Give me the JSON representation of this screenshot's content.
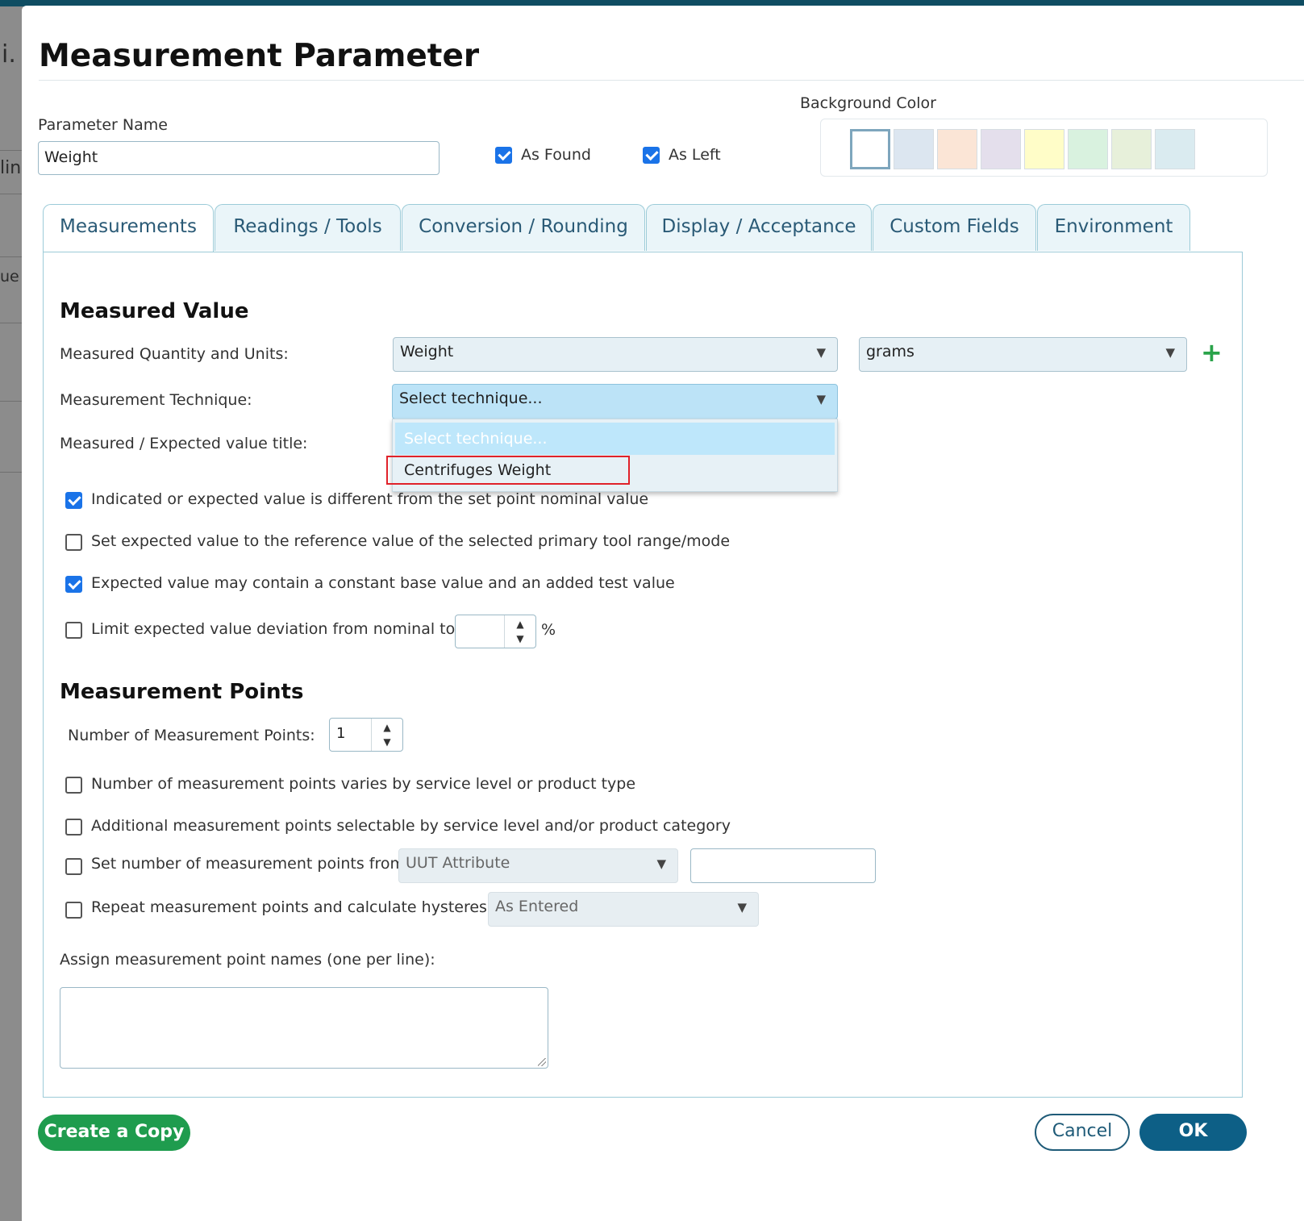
{
  "background_fragments": {
    "frag1": "i.",
    "frag2": "lin",
    "frag3": "ue"
  },
  "dialog": {
    "title": "Measurement Parameter",
    "parameter_name_label": "Parameter Name",
    "parameter_name_value": "Weight",
    "as_found_label": "As Found",
    "as_found_checked": true,
    "as_left_label": "As Left",
    "as_left_checked": true,
    "background_color_label": "Background Color",
    "background_colors": [
      "#ffffff",
      "#dce6f0",
      "#fbe5d6",
      "#e4dfec",
      "#fffdc8",
      "#d9f2df",
      "#e7f0da",
      "#daebf0"
    ],
    "selected_color_index": 0
  },
  "tabs": [
    "Measurements",
    "Readings / Tools",
    "Conversion / Rounding",
    "Display / Acceptance",
    "Custom Fields",
    "Environment"
  ],
  "active_tab": "Measurements",
  "measured_value": {
    "heading": "Measured Value",
    "quantity_label": "Measured Quantity and Units:",
    "quantity_value": "Weight",
    "units_value": "grams",
    "technique_label": "Measurement Technique:",
    "technique_value": "Select technique...",
    "technique_options": [
      "Select technique...",
      "Centrifuges Weight"
    ],
    "title_label": "Measured / Expected value title:",
    "options": [
      {
        "label": "Indicated or expected value is different from the set point nominal value",
        "checked": true
      },
      {
        "label": "Set expected value to the reference value of the selected primary tool range/mode",
        "checked": false
      },
      {
        "label": "Expected value may contain a constant base value and an added test value",
        "checked": true
      },
      {
        "label": "Limit expected value deviation from nominal to",
        "checked": false
      }
    ],
    "deviation_value": "",
    "deviation_unit": "%"
  },
  "measurement_points": {
    "heading": "Measurement Points",
    "count_label": "Number of Measurement Points:",
    "count_value": "1",
    "varies_label": "Number of measurement points varies by service level or product type",
    "additional_label": "Additional measurement points selectable by service level and/or product category",
    "set_from_label": "Set number of measurement points from",
    "set_from_select": "UUT Attribute",
    "set_from_value": "",
    "repeat_label": "Repeat measurement points and calculate hysteresis",
    "repeat_select": "As Entered",
    "names_label": "Assign measurement point names (one per line):",
    "names_value": ""
  },
  "buttons": {
    "create_copy": "Create a Copy",
    "cancel": "Cancel",
    "ok": "OK"
  },
  "colors": {
    "primary": "#0d5f86",
    "success": "#1f9c4e",
    "accent": "#2aa34a",
    "highlight": "#e0222a"
  },
  "icons": {
    "add": "plus-icon",
    "dropdown": "chevron-down-icon",
    "spinner": "spinner-arrows-icon",
    "resize": "resize-grip-icon"
  }
}
